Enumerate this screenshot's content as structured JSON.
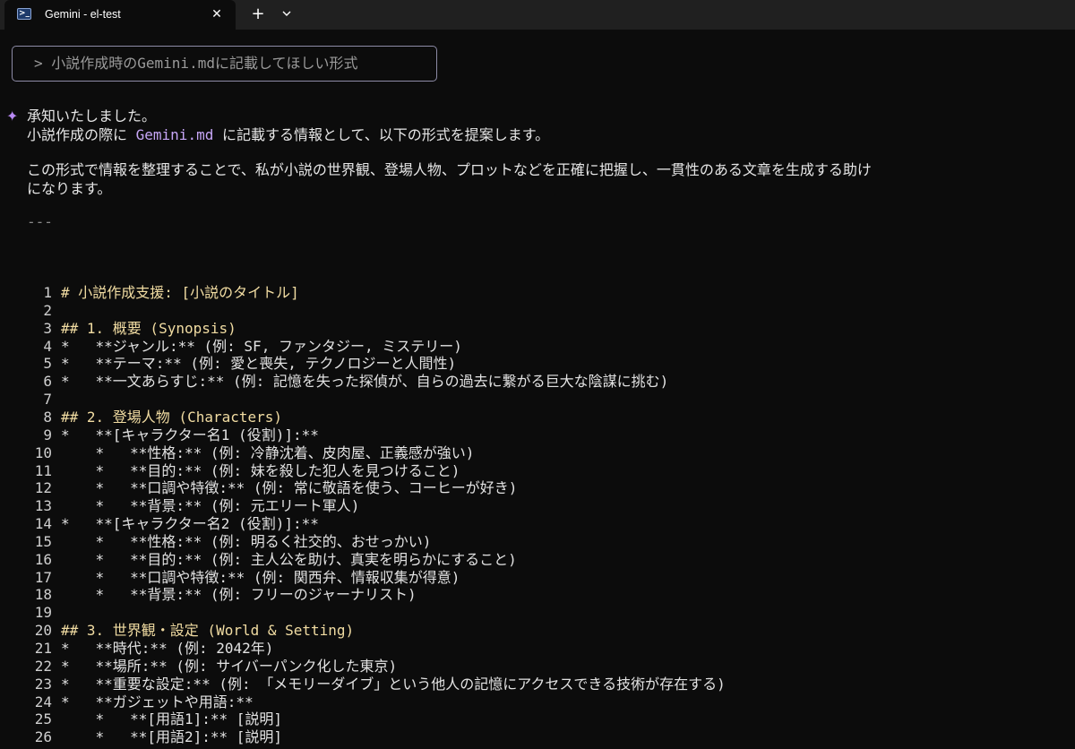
{
  "tab": {
    "title": "Gemini - el-test",
    "icon": "terminal-icon",
    "close": "✕",
    "new_tab": "+"
  },
  "prompt": {
    "text": "> 小説作成時のGemini.mdに記載してほしい形式"
  },
  "response": {
    "marker": "✦",
    "line1": "承知いたしました。",
    "line2_before": "小説作成の際に ",
    "line2_code": "Gemini.md",
    "line2_after": " に記載する情報として、以下の形式を提案します。",
    "line3": "この形式で情報を整理することで、私が小説の世界観、登場人物、プロットなどを正確に把握し、一貫性のある文章を生成する助け",
    "line4": "になります。",
    "hr": "---"
  },
  "code_lines": [
    {
      "n": "1",
      "text": "# 小説作成支援: [小説のタイトル]",
      "heading": true
    },
    {
      "n": "2",
      "text": "",
      "heading": false
    },
    {
      "n": "3",
      "text": "## 1. 概要 (Synopsis)",
      "heading": true
    },
    {
      "n": "4",
      "text": "*   **ジャンル:** (例: SF, ファンタジー, ミステリー)",
      "heading": false
    },
    {
      "n": "5",
      "text": "*   **テーマ:** (例: 愛と喪失, テクノロジーと人間性)",
      "heading": false
    },
    {
      "n": "6",
      "text": "*   **一文あらすじ:** (例: 記憶を失った探偵が、自らの過去に繋がる巨大な陰謀に挑む)",
      "heading": false
    },
    {
      "n": "7",
      "text": "",
      "heading": false
    },
    {
      "n": "8",
      "text": "## 2. 登場人物 (Characters)",
      "heading": true
    },
    {
      "n": "9",
      "text": "*   **[キャラクター名1 (役割)]:**",
      "heading": false
    },
    {
      "n": "10",
      "text": "    *   **性格:** (例: 冷静沈着、皮肉屋、正義感が強い)",
      "heading": false
    },
    {
      "n": "11",
      "text": "    *   **目的:** (例: 妹を殺した犯人を見つけること)",
      "heading": false
    },
    {
      "n": "12",
      "text": "    *   **口調や特徴:** (例: 常に敬語を使う、コーヒーが好き)",
      "heading": false
    },
    {
      "n": "13",
      "text": "    *   **背景:** (例: 元エリート軍人)",
      "heading": false
    },
    {
      "n": "14",
      "text": "*   **[キャラクター名2 (役割)]:**",
      "heading": false
    },
    {
      "n": "15",
      "text": "    *   **性格:** (例: 明るく社交的、おせっかい)",
      "heading": false
    },
    {
      "n": "16",
      "text": "    *   **目的:** (例: 主人公を助け、真実を明らかにすること)",
      "heading": false
    },
    {
      "n": "17",
      "text": "    *   **口調や特徴:** (例: 関西弁、情報収集が得意)",
      "heading": false
    },
    {
      "n": "18",
      "text": "    *   **背景:** (例: フリーのジャーナリスト)",
      "heading": false
    },
    {
      "n": "19",
      "text": "",
      "heading": false
    },
    {
      "n": "20",
      "text": "## 3. 世界観・設定 (World & Setting)",
      "heading": true
    },
    {
      "n": "21",
      "text": "*   **時代:** (例: 2042年)",
      "heading": false
    },
    {
      "n": "22",
      "text": "*   **場所:** (例: サイバーパンク化した東京)",
      "heading": false
    },
    {
      "n": "23",
      "text": "*   **重要な設定:** (例: 「メモリーダイブ」という他人の記憶にアクセスできる技術が存在する)",
      "heading": false
    },
    {
      "n": "24",
      "text": "*   **ガジェットや用語:**",
      "heading": false
    },
    {
      "n": "25",
      "text": "    *   **[用語1]:** [説明]",
      "heading": false
    },
    {
      "n": "26",
      "text": "    *   **[用語2]:** [説明]",
      "heading": false
    }
  ]
}
